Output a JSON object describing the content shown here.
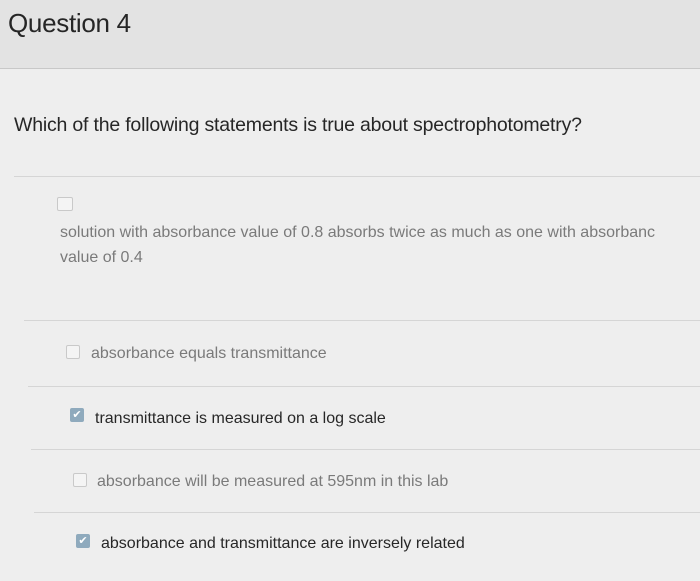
{
  "question": {
    "title": "Question 4",
    "prompt": "Which of the following statements is true about spectrophotometry?"
  },
  "options": [
    {
      "line1": "solution with absorbance value of 0.8 absorbs twice as much as one with absorbanc",
      "line2": "value of 0.4",
      "checked": false
    },
    {
      "label": "absorbance equals transmittance",
      "checked": false
    },
    {
      "label": "transmittance is measured on a log scale",
      "checked": true
    },
    {
      "label": "absorbance will be measured at 595nm in this lab",
      "checked": false
    },
    {
      "label": "absorbance and transmittance are inversely related",
      "checked": true
    }
  ],
  "icons": {
    "checked_glyph": "✔"
  },
  "colors": {
    "checkbox_checked": "#8faabd",
    "checkbox_unchecked": "#f4f4f4",
    "header_bg": "#e3e3e3",
    "page_bg": "#eeeeee"
  }
}
